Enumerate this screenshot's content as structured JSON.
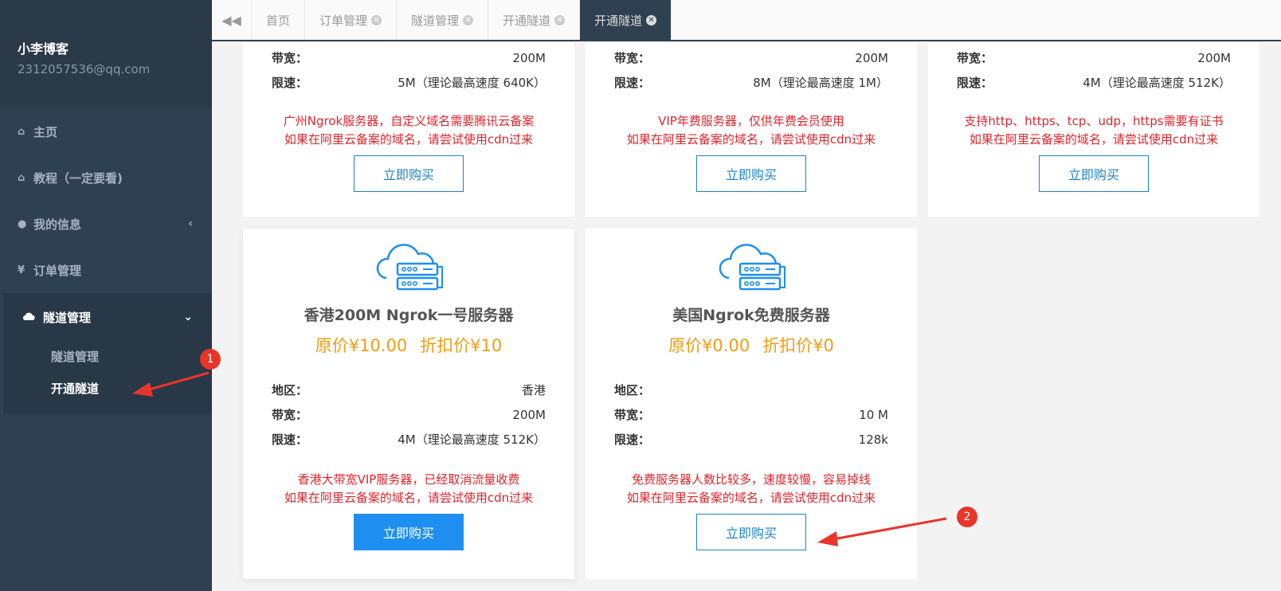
{
  "user": {
    "name": "小李博客",
    "email": "2312057536@qq.com"
  },
  "nav": [
    {
      "label": "主页",
      "icon": "home-icon"
    },
    {
      "label": "教程（一定要看)",
      "icon": "home-icon"
    },
    {
      "label": "我的信息",
      "icon": "user-icon"
    },
    {
      "label": "订单管理",
      "icon": "yen-icon"
    }
  ],
  "nav_active": {
    "label": "隧道管理",
    "icon": "cloud-icon",
    "sub": [
      "隧道管理",
      "开通隧道"
    ]
  },
  "tabs": [
    "首页",
    "订单管理",
    "隧道管理",
    "开通隧道",
    "开通隧道"
  ],
  "labels": {
    "region": "地区：",
    "bandwidth": "带宽：",
    "limit": "限速：",
    "buy": "立即购买"
  },
  "cards_top": [
    {
      "bandwidth": "200M",
      "limit": "5M（理论最高速度 640K）",
      "note1": "广州Ngrok服务器，自定义域名需要腾讯云备案",
      "note2": "如果在阿里云备案的域名，请尝试使用cdn过来"
    },
    {
      "bandwidth": "200M",
      "limit": "8M（理论最高速度 1M）",
      "note1": "VIP年费服务器，仅供年费会员使用",
      "note2": "如果在阿里云备案的域名，请尝试使用cdn过来"
    },
    {
      "bandwidth": "200M",
      "limit": "4M（理论最高速度 512K）",
      "note1": "支持http、https、tcp、udp，https需要有证书",
      "note2": "如果在阿里云备案的域名，请尝试使用cdn过来"
    }
  ],
  "cards_bottom": [
    {
      "title": "香港200M Ngrok一号服务器",
      "orig": "原价¥10.00",
      "disc": "折扣价¥10",
      "region": "香港",
      "bandwidth": "200M",
      "limit": "4M（理论最高速度 512K）",
      "note1": "香港大带宽VIP服务器，已经取消流量收费",
      "note2": "如果在阿里云备案的域名，请尝试使用cdn过来"
    },
    {
      "title": "美国Ngrok免费服务器",
      "orig": "原价¥0.00",
      "disc": "折扣价¥0",
      "region": "",
      "bandwidth": "10 M",
      "limit": "128k",
      "note1": "免费服务器人数比较多，速度较慢，容易掉线",
      "note2": "如果在阿里云备案的域名，请尝试使用cdn过来"
    }
  ],
  "badges": [
    "1",
    "2"
  ],
  "colors": {
    "sidebar": "#2f4050",
    "accent": "#1c84c6",
    "price": "#f39c12",
    "note": "#e0242c",
    "annot": "#e8352a"
  }
}
